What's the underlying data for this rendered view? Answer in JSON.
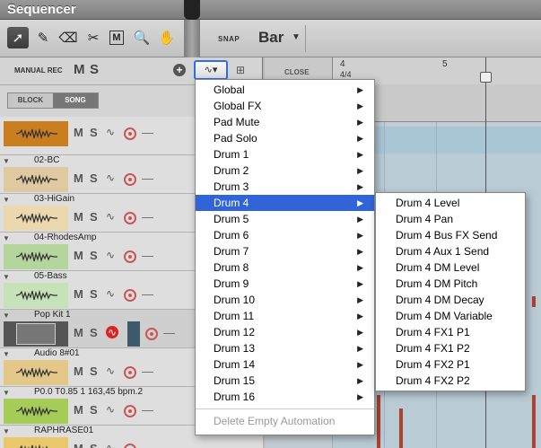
{
  "window": {
    "title": "Sequencer"
  },
  "toolbar": {
    "tools": [
      {
        "name": "pointer-tool",
        "glyph": "➚"
      },
      {
        "name": "pencil-tool",
        "glyph": "✎"
      },
      {
        "name": "eraser-tool",
        "glyph": "⌫"
      },
      {
        "name": "razor-tool",
        "glyph": "✂"
      },
      {
        "name": "mute-tool",
        "glyph": "M"
      },
      {
        "name": "magnify-tool",
        "glyph": "🔍"
      },
      {
        "name": "hand-tool",
        "glyph": "✋"
      }
    ],
    "snap_label": "SNAP",
    "snap_value": "Bar"
  },
  "panel": {
    "manual_rec": "MANUAL REC",
    "m": "M",
    "s": "S",
    "add": "+",
    "auto_btn": "∿▾",
    "block": "BLOCK",
    "song": "SONG",
    "close": "CLOSE"
  },
  "tracks": [
    {
      "name": "",
      "color": "#c97f1f"
    },
    {
      "name": "02-BC",
      "color": "#e0c8a0"
    },
    {
      "name": "03-HiGain",
      "color": "#ecd8ae"
    },
    {
      "name": "04-RhodesAmp",
      "color": "#b4d69c"
    },
    {
      "name": "05-Bass",
      "color": "#c6e2b8"
    },
    {
      "name": "Pop Kit 1",
      "color": "#555555"
    },
    {
      "name": "Audio 8#01",
      "color": "#e4c88a"
    },
    {
      "name": "P0.0 T0.85 1 163,45 bpm.2",
      "color": "#a6cc58"
    },
    {
      "name": "RAPHRASE01",
      "color": "#e8c86a"
    }
  ],
  "ruler": {
    "bar4": "4",
    "timesig": "4/4",
    "bar5": "5"
  },
  "menu": {
    "items": [
      "Global",
      "Global FX",
      "Pad Mute",
      "Pad Solo",
      "Drum 1",
      "Drum 2",
      "Drum 3",
      "Drum 4",
      "Drum 5",
      "Drum 6",
      "Drum 7",
      "Drum 8",
      "Drum 9",
      "Drum 10",
      "Drum 11",
      "Drum 12",
      "Drum 13",
      "Drum 14",
      "Drum 15",
      "Drum 16"
    ],
    "highlighted": "Drum 4",
    "delete_label": "Delete Empty Automation"
  },
  "submenu": {
    "items": [
      "Drum 4 Level",
      "Drum 4 Pan",
      "Drum 4 Bus FX Send",
      "Drum 4 Aux 1 Send",
      "Drum 4 DM Level",
      "Drum 4 DM Pitch",
      "Drum 4 DM Decay",
      "Drum 4 DM Variable",
      "Drum 4 FX1 P1",
      "Drum 4 FX1 P2",
      "Drum 4 FX2 P1",
      "Drum 4 FX2 P2"
    ]
  }
}
